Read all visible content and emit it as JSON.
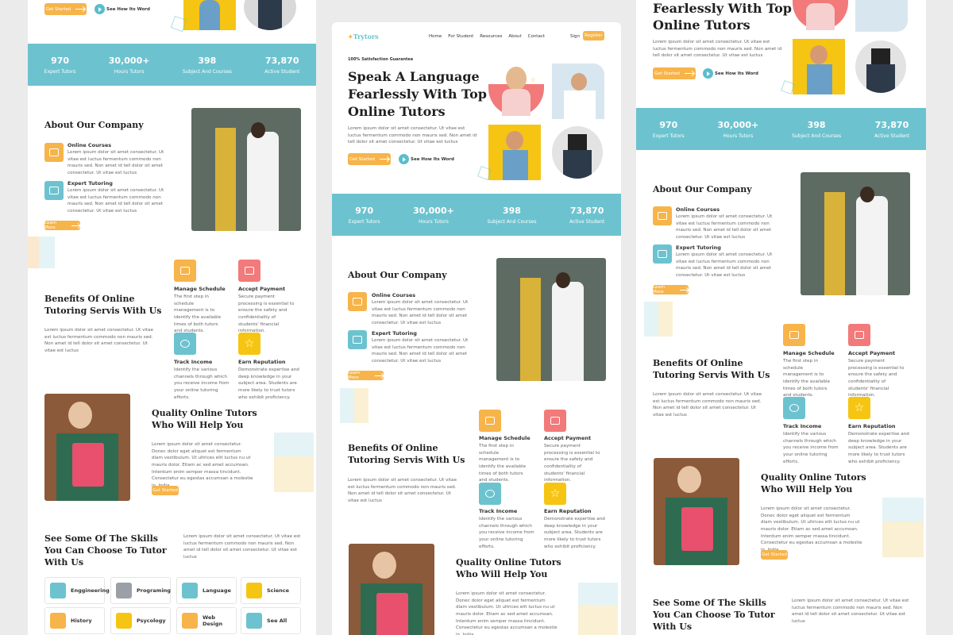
{
  "brand": {
    "name": "Trytors"
  },
  "nav": {
    "items": [
      "Home",
      "For Student",
      "Resources",
      "About",
      "Contact"
    ],
    "signin": "Sign",
    "register": "Register"
  },
  "hero": {
    "tag": "100% Satisfaction Guarantee",
    "title_lines": [
      "Speak A Language",
      "Fearlessly With Top",
      "Online Tutors"
    ],
    "title_partial": [
      "Fearlessly With Top",
      "Online Tutors"
    ],
    "body": "Lorem ipsum dolor sit amet consectetur. Ut vitae est luctus fermentum commodo non mauris sed. Non amet id tell dolor sit amet consectetur. Ut vitae est luctus",
    "cta": "Get Started",
    "watch": "See How Its Word"
  },
  "stats": [
    {
      "value": "970",
      "label": "Expert Tutors"
    },
    {
      "value": "30,000+",
      "label": "Hours Tutors"
    },
    {
      "value": "398",
      "label": "Subject And Courses"
    },
    {
      "value": "73,870",
      "label": "Active Student"
    }
  ],
  "about": {
    "title": "About Our Company",
    "items": [
      {
        "title": "Online Courses",
        "body": "Lorem ipsum dolor sit amet consectetur. Ut vitae est luctus fermentum commodo non mauris sed. Non amet id tell dolor sit amet consectetur. Ut vitae est luctus"
      },
      {
        "title": "Expert Tutoring",
        "body": "Lorem ipsum dolor sit amet consectetur. Ut vitae est luctus fermentum commodo non mauris sed. Non amet id tell dolor sit amet consectetur. Ut vitae est luctus"
      }
    ],
    "cta": "Learn More"
  },
  "benefits": {
    "title_lines": [
      "Benefits Of Online",
      "Tutoring Servis With Us"
    ],
    "body": "Lorem ipsum dolor sit amet consectetur. Ut vitae est luctus fermentum commodo non mauris sed. Non amet id tell dolor sit amet consectetur. Ut vitae est luctus",
    "items": [
      {
        "title": "Manage Schedule",
        "body": "The first step in schedule management is to identify the available times of both tutors and students."
      },
      {
        "title": "Accept Payment",
        "body": "Secure payment processing is essential to ensure the safety and confidentiality of students' financial information."
      },
      {
        "title": "Track Income",
        "body": "Identify the various channels through which you receive income from your online tutoring efforts."
      },
      {
        "title": "Earn Reputation",
        "body": "Demonstrate expertise and deep knowledge in your subject area. Students are more likely to trust tutors who exhibit proficiency."
      }
    ]
  },
  "quality": {
    "title_lines": [
      "Quality Online Tutors",
      "Who Will Help You"
    ],
    "body": "Lorem ipsum dolor sit amet consectetur. Donec dolor eget aliquet est fermentum diam vestibulum. Ut ultrices elit luctus nu ut mauris dolor. Etiam ac sed amet accumsan. Interdum enim semper massa tincidunt. Consectetur eu egestas accumsan a molestie in. India.",
    "cta": "Get Started"
  },
  "skills": {
    "title_lines": [
      "See Some Of The Skills",
      "You Can Choose To Tutor",
      "With Us"
    ],
    "body": "Lorem ipsum dolor sit amet consectetur. Ut vitae est luctus fermentum commodo non mauris sed. Non amet id tell dolor sit amet consectetur. Ut vitae est luctus",
    "items": [
      {
        "label": "Enggineering",
        "color": "#6cc3cf"
      },
      {
        "label": "Programing",
        "color": "#9aa0a6"
      },
      {
        "label": "Language",
        "color": "#6cc3cf"
      },
      {
        "label": "Science",
        "color": "#f6c513"
      },
      {
        "label": "History",
        "color": "#f7b44a"
      },
      {
        "label": "Psycology",
        "color": "#f6c513"
      },
      {
        "label": "Web Design",
        "color": "#f7b44a"
      },
      {
        "label": "See All",
        "color": "#6cc3cf"
      }
    ]
  }
}
